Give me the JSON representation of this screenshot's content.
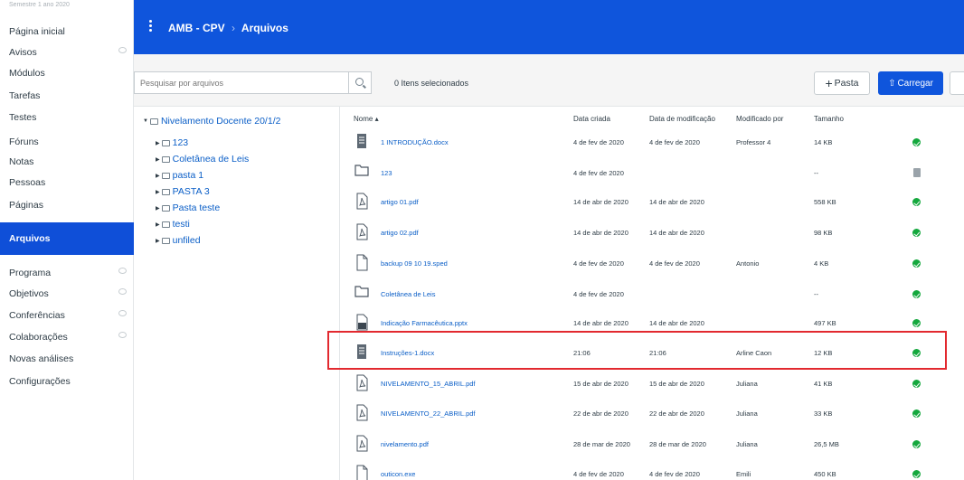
{
  "course_nav": {
    "term": "Semestre 1 ano 2020",
    "items": [
      {
        "label": "Página inicial",
        "hidden": false
      },
      {
        "label": "Avisos",
        "hidden": true
      },
      {
        "label": "Módulos",
        "hidden": false
      },
      {
        "label": "Tarefas",
        "hidden": false
      },
      {
        "label": "Testes",
        "hidden": false
      },
      {
        "label": "Fóruns",
        "hidden": false
      },
      {
        "label": "Notas",
        "hidden": false
      },
      {
        "label": "Pessoas",
        "hidden": false
      },
      {
        "label": "Páginas",
        "hidden": false
      },
      {
        "label": "Arquivos",
        "hidden": false,
        "active": true
      },
      {
        "label": "Programa",
        "hidden": true
      },
      {
        "label": "Objetivos",
        "hidden": true
      },
      {
        "label": "Conferências",
        "hidden": true
      },
      {
        "label": "Colaborações",
        "hidden": true
      },
      {
        "label": "Novas análises",
        "hidden": false
      },
      {
        "label": "Configurações",
        "hidden": false
      }
    ]
  },
  "header": {
    "course": "AMB - CPV",
    "separator": "›",
    "section": "Arquivos"
  },
  "toolbar": {
    "search_placeholder": "Pesquisar por arquivos",
    "selected_count": "0 Itens selecionados",
    "folder_button": "Pasta",
    "upload_button": "Carregar"
  },
  "tree": {
    "root": "Nivelamento Docente 20/1/2",
    "folders": [
      "123",
      "Coletânea de Leis",
      "pasta 1",
      "PASTA 3",
      "Pasta teste",
      "testi",
      "unfiled"
    ]
  },
  "columns": {
    "name": "Nome ▴",
    "created": "Data criada",
    "modified": "Data de modificação",
    "modified_by": "Modificado por",
    "size": "Tamanho"
  },
  "files": [
    {
      "name": "1 INTRODUÇÃO.docx",
      "icon": "document-icon",
      "created": "4 de fev de 2020",
      "modified": "4 de fev de 2020",
      "by": "Professor 4",
      "size": "14 KB",
      "status": "ok"
    },
    {
      "name": "123",
      "icon": "folder-icon",
      "created": "4 de fev de 2020",
      "modified": "",
      "by": "",
      "size": "--",
      "status": "na"
    },
    {
      "name": "artigo 01.pdf",
      "icon": "pdf-icon",
      "created": "14 de abr de 2020",
      "modified": "14 de abr de 2020",
      "by": "",
      "size": "558 KB",
      "status": "ok"
    },
    {
      "name": "artigo 02.pdf",
      "icon": "pdf-icon",
      "created": "14 de abr de 2020",
      "modified": "14 de abr de 2020",
      "by": "",
      "size": "98 KB",
      "status": "ok"
    },
    {
      "name": "backup 09 10 19.sped",
      "icon": "file-icon",
      "created": "4 de fev de 2020",
      "modified": "4 de fev de 2020",
      "by": "Antonio",
      "size": "4 KB",
      "status": "ok"
    },
    {
      "name": "Coletânea de Leis",
      "icon": "folder-icon",
      "created": "4 de fev de 2020",
      "modified": "",
      "by": "",
      "size": "--",
      "status": "ok"
    },
    {
      "name": "Indicação Farmacêutica.pptx",
      "icon": "slides-icon",
      "created": "14 de abr de 2020",
      "modified": "14 de abr de 2020",
      "by": "",
      "size": "497 KB",
      "status": "ok"
    },
    {
      "name": "Instruções-1.docx",
      "icon": "document-icon",
      "created": "21:06",
      "modified": "21:06",
      "by": "Arline Caon",
      "size": "12 KB",
      "status": "ok"
    },
    {
      "name": "NIVELAMENTO_15_ABRIL.pdf",
      "icon": "pdf-icon",
      "created": "15 de abr de 2020",
      "modified": "15 de abr de 2020",
      "by": "Juliana",
      "size": "41 KB",
      "status": "ok"
    },
    {
      "name": "NIVELAMENTO_22_ABRIL.pdf",
      "icon": "pdf-icon",
      "created": "22 de abr de 2020",
      "modified": "22 de abr de 2020",
      "by": "Juliana",
      "size": "33 KB",
      "status": "ok"
    },
    {
      "name": "nivelamento.pdf",
      "icon": "pdf-icon",
      "created": "28 de mar de 2020",
      "modified": "28 de mar de 2020",
      "by": "Juliana",
      "size": "26,5 MB",
      "status": "ok"
    },
    {
      "name": "outicon.exe",
      "icon": "file-icon",
      "created": "4 de fev de 2020",
      "modified": "4 de fev de 2020",
      "by": "Emili",
      "size": "450 KB",
      "status": "ok"
    }
  ],
  "colors": {
    "brand": "#0f55dc",
    "link": "#0a5ec7",
    "ok": "#14a83d",
    "highlight": "#e2292f"
  }
}
